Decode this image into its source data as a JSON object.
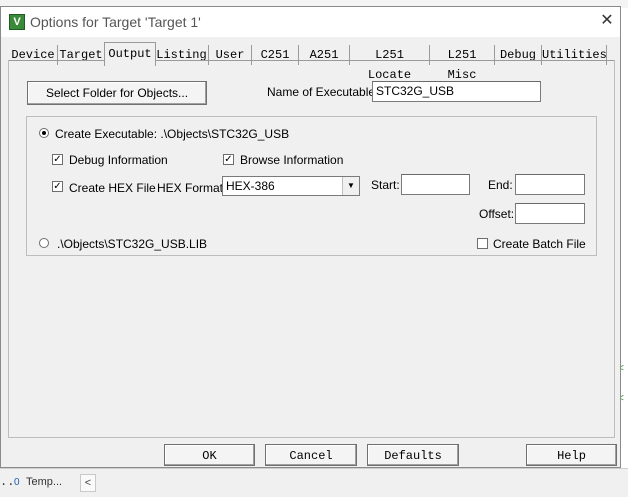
{
  "background": {
    "status_text": "..",
    "template_label": "Temp...",
    "scroll_left_glyph": "<"
  },
  "dialog": {
    "title": "Options for Target 'Target 1'",
    "icon_letter": "V",
    "close_glyph": "✕"
  },
  "tabs": [
    {
      "label": "Device"
    },
    {
      "label": "Target"
    },
    {
      "label": "Output"
    },
    {
      "label": "Listing"
    },
    {
      "label": "User"
    },
    {
      "label": "C251"
    },
    {
      "label": "A251"
    },
    {
      "label": "L251 Locate"
    },
    {
      "label": "L251 Misc"
    },
    {
      "label": "Debug"
    },
    {
      "label": "Utilities"
    }
  ],
  "output": {
    "select_folder_label": "Select Folder for Objects...",
    "name_exe_label": "Name of Executable:",
    "name_exe_value": "STC32G_USB",
    "create_exe_label": "Create Executable:  .\\Objects\\STC32G_USB",
    "debug_info_label": "Debug Information",
    "debug_info_checked": true,
    "browse_info_label": "Browse Information",
    "browse_info_checked": true,
    "create_hex_label": "Create HEX File",
    "create_hex_checked": true,
    "hex_format_label": "HEX Format:",
    "hex_format_value": "HEX-386",
    "start_label": "Start:",
    "start_value": "",
    "end_label": "End:",
    "end_value": "",
    "offset_label": "Offset:",
    "offset_value": "",
    "lib_label": ".\\Objects\\STC32G_USB.LIB",
    "create_batch_label": "Create Batch File",
    "create_batch_checked": false
  },
  "footer": {
    "ok": "OK",
    "cancel": "Cancel",
    "defaults": "Defaults",
    "help": "Help"
  }
}
